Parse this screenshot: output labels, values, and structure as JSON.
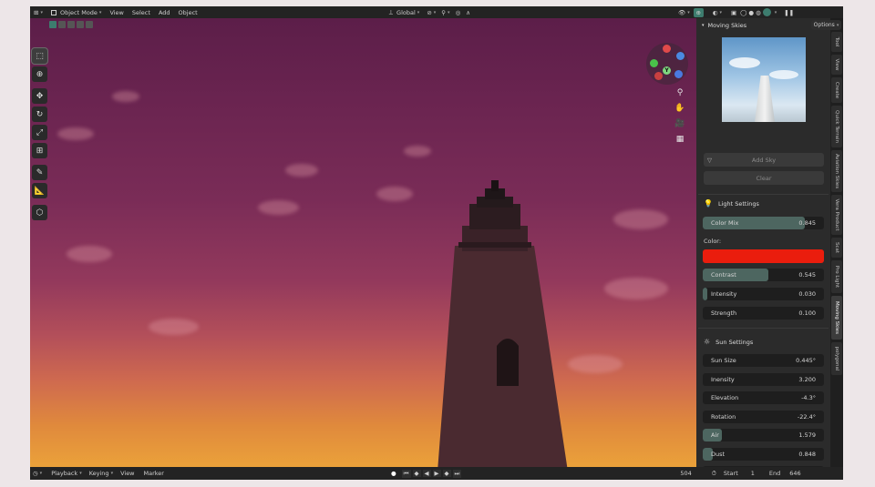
{
  "header": {
    "mode": "Object Mode",
    "menus": [
      "View",
      "Select",
      "Add",
      "Object"
    ],
    "orientation": "Global",
    "options": "Options"
  },
  "toolbar": {
    "tools": [
      "select-box-icon",
      "cursor-icon",
      "move-icon",
      "rotate-icon",
      "scale-icon",
      "transform-icon",
      "annotate-icon",
      "measure-icon",
      "add-cube-icon"
    ]
  },
  "panel": {
    "title": "Moving Skies",
    "add_sky": "Add Sky",
    "clear": "Clear",
    "light_settings": {
      "title": "Light Settings",
      "color_mix_label": "Color Mix",
      "color_mix_value": "0.845",
      "color_mix_fraction": 0.845,
      "color_label": "Color:",
      "color_hex": "#ea1d0d",
      "contrast_label": "Contrast",
      "contrast_value": "0.545",
      "contrast_fraction": 0.545,
      "intensity_label": "Intensity",
      "intensity_value": "0.030",
      "intensity_fraction": 0.03,
      "strength_label": "Strength",
      "strength_value": "0.100"
    },
    "sun_settings": {
      "title": "Sun Settings",
      "sun_size_label": "Sun Size",
      "sun_size_value": "0.445°",
      "inensity_label": "Inensity",
      "inensity_value": "3.200",
      "elevation_label": "Elevation",
      "elevation_value": "-4.3°",
      "rotation_label": "Rotation",
      "rotation_value": "-22.4°",
      "air_label": "Air",
      "air_value": "1.579",
      "air_fraction": 0.158,
      "dust_label": "Dust",
      "dust_value": "0.848",
      "dust_fraction": 0.085
    }
  },
  "tabs": [
    "Tool",
    "View",
    "Create",
    "Quick Terrain",
    "Aviation Skies",
    "Vera Product",
    "Scat",
    "Pro Light",
    "Moving Skies",
    "polygonal"
  ],
  "tabs_active": "Moving Skies",
  "timeline": {
    "playback": "Playback",
    "keying": "Keying",
    "view": "View",
    "marker": "Marker",
    "current_frame": "504",
    "start_label": "Start",
    "start_value": "1",
    "end_label": "End",
    "end_value": "646"
  },
  "gizmo": {
    "y_label": "Y"
  },
  "colors": {
    "accent": "#4d6660",
    "sky_top": "#5c1e49",
    "sky_bottom": "#eca43a"
  }
}
